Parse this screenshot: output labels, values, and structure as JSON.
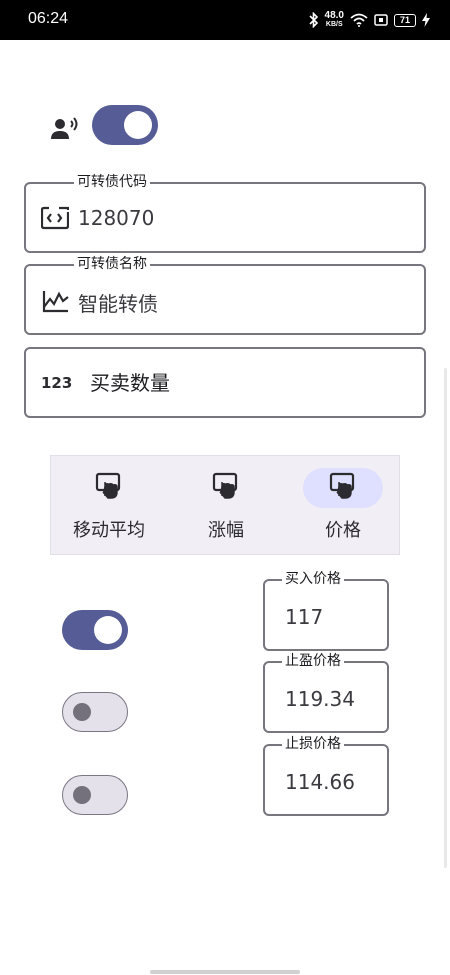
{
  "status_bar": {
    "time": "06:24",
    "net_speed_value": "48.0",
    "net_speed_unit": "KB/S",
    "battery": "71",
    "icons": [
      "bluetooth-icon",
      "wifi-icon",
      "nfc-icon",
      "battery-icon",
      "charging-icon"
    ]
  },
  "voice_toggle": {
    "icon": "voice-announce-icon",
    "state": "on"
  },
  "fields": {
    "bond_code": {
      "label": "可转债代码",
      "value": "128070",
      "icon": "code-icon"
    },
    "bond_name": {
      "label": "可转债名称",
      "value": "智能转债",
      "icon": "trend-chart-icon"
    },
    "quantity": {
      "placeholder": "买卖数量",
      "icon": "numbers-123-icon",
      "icon_text": "123"
    }
  },
  "mode_selector": {
    "selected": "价格",
    "items": [
      {
        "label": "移动平均",
        "icon": "touch-screen-icon"
      },
      {
        "label": "涨幅",
        "icon": "touch-screen-icon"
      },
      {
        "label": "价格",
        "icon": "touch-screen-icon"
      }
    ]
  },
  "price_rows": [
    {
      "switch_state": "on",
      "label": "买入价格",
      "value": "117"
    },
    {
      "switch_state": "off",
      "label": "止盈价格",
      "value": "119.34"
    },
    {
      "switch_state": "off",
      "label": "止损价格",
      "value": "114.66"
    }
  ],
  "colors": {
    "primary": "#565c96",
    "selected_pill": "#dfe0ff",
    "outline": "#77767e",
    "segment_bg": "#f1eef6"
  }
}
